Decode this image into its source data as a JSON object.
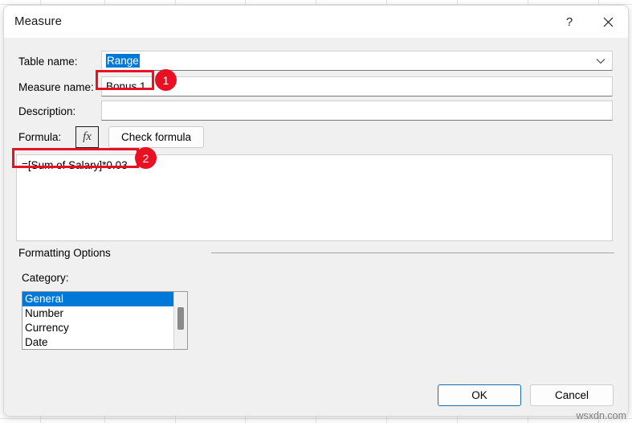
{
  "window": {
    "title": "Measure",
    "help_icon": "question-mark-icon",
    "close_icon": "close-x-icon"
  },
  "form": {
    "table_name": {
      "label": "Table name:",
      "value": "Range",
      "arrow_icon": "chevron-down-icon"
    },
    "measure_name": {
      "label": "Measure name:",
      "value": "Bonus 1",
      "placeholder": ""
    },
    "description": {
      "label": "Description:",
      "value": "",
      "placeholder": ""
    },
    "formula": {
      "label": "Formula:",
      "fx_label": "fx",
      "check_button_label": "Check formula",
      "value": "=[Sum of Salary]*0.03"
    }
  },
  "formatting_options": {
    "group_label": "Formatting Options",
    "category_label": "Category:",
    "categories": [
      {
        "label": "General",
        "selected": true
      },
      {
        "label": "Number",
        "selected": false
      },
      {
        "label": "Currency",
        "selected": false
      },
      {
        "label": "Date",
        "selected": false
      }
    ]
  },
  "footer": {
    "ok_label": "OK",
    "cancel_label": "Cancel"
  },
  "annotations": [
    {
      "badge": "1",
      "target": "measure-name-field"
    },
    {
      "badge": "2",
      "target": "formula-text"
    }
  ],
  "watermark": "wsxdn.com",
  "colors": {
    "accent_selection": "#0078d7",
    "annotation_red": "#e81123",
    "dialog_background": "#f0f0f0",
    "titlebar_background": "#ffffff",
    "default_button_border": "#1b6eae"
  }
}
